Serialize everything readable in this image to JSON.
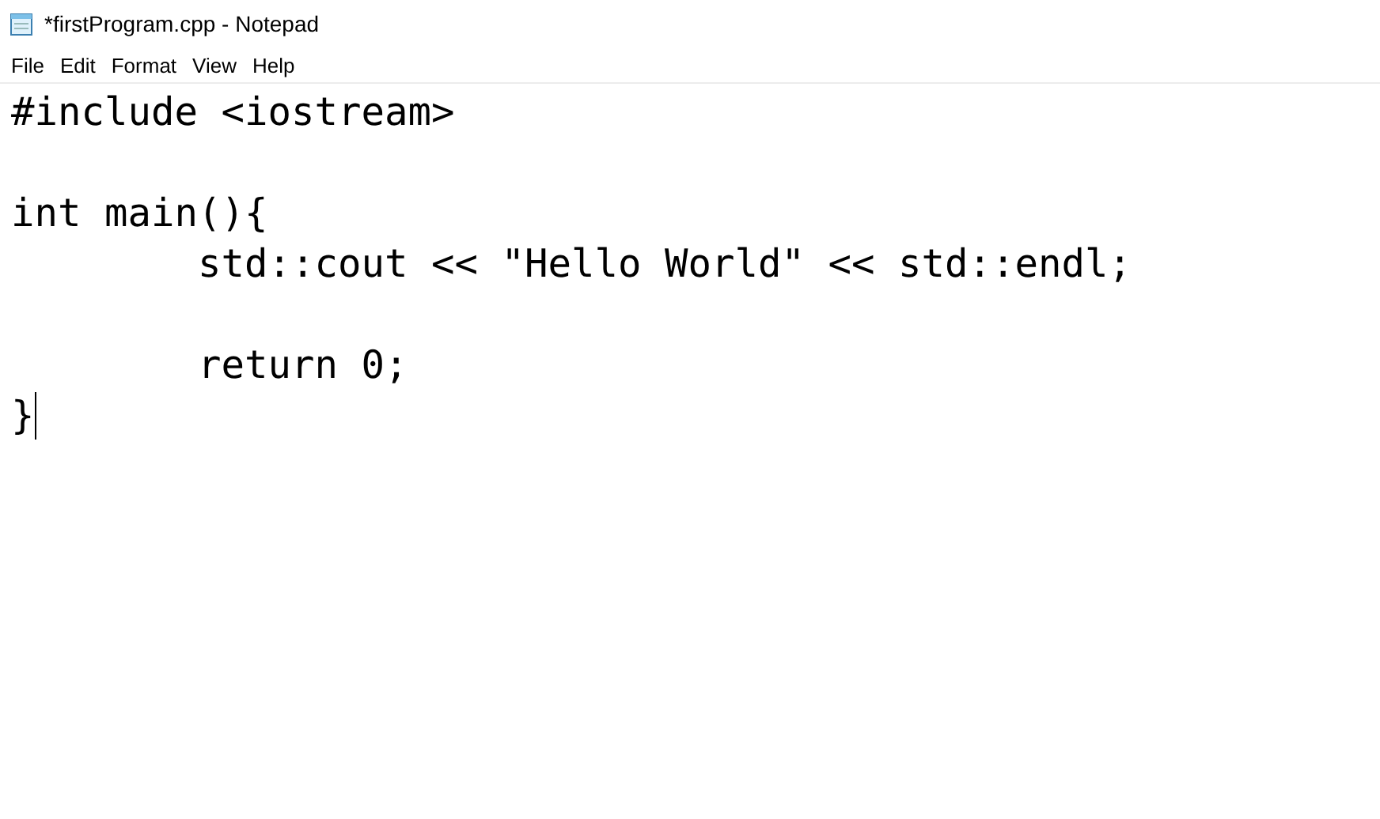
{
  "window": {
    "title": "*firstProgram.cpp - Notepad"
  },
  "menu": [
    "File",
    "Edit",
    "Format",
    "View",
    "Help"
  ],
  "editor": {
    "text": "#include <iostream>\n\nint main(){\n\tstd::cout << \"Hello World\" << std::endl;\n\n\treturn 0;\n}"
  }
}
